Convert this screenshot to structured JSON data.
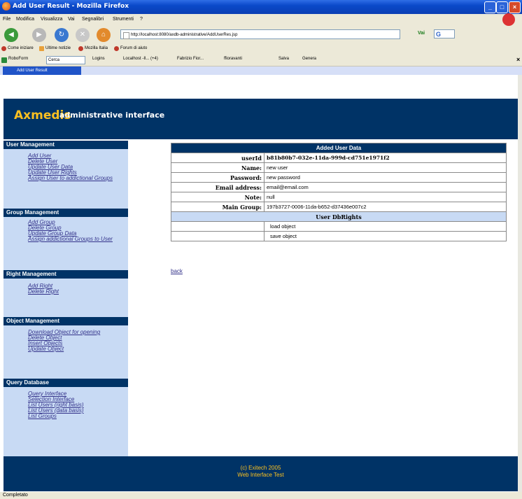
{
  "window": {
    "title": "Add User Result - Mozilla Firefox"
  },
  "menu": [
    "File",
    "Modifica",
    "Visualizza",
    "Vai",
    "Segnalibri",
    "Strumenti",
    "?"
  ],
  "address": {
    "url": "http://localhost:8080/axdb-administrative/AddUserRes.jsp",
    "go_label": "Vai"
  },
  "bookmarks": [
    "Come iniziare",
    "Ultime notizie",
    "Mozilla Italia",
    "Forum di aiuto"
  ],
  "toolbar2": {
    "roboform": "RoboForm",
    "search": "Cerca",
    "logins": "Logins",
    "localhost": "Localhost -Il... (+4)",
    "fabrizio": "Fabrizio Fior...",
    "fioravanti": "ffioravanti",
    "salva": "Salva",
    "genera": "Genera"
  },
  "tab": {
    "label": "Add User Result"
  },
  "header": {
    "brand": "Axmedis",
    "subtitle": "administrative interface"
  },
  "sidebar": [
    {
      "title": "User Management",
      "links": [
        "Add User",
        "Delete User",
        "Update User Data",
        "Update User Rights",
        "Assign User to addictional Groups"
      ]
    },
    {
      "title": "Group Management",
      "links": [
        "Add Group",
        "Delete Group",
        "Update Group Data",
        "Assign addictional Groups to User"
      ]
    },
    {
      "title": "Right Management",
      "links": [
        "Add Right",
        "Delete Right"
      ]
    },
    {
      "title": "Object Management",
      "links": [
        "Download Object for opening",
        "Delete Object",
        "Insert Objects",
        "Update Object"
      ]
    },
    {
      "title": "Query Database",
      "links": [
        "Query Interface",
        "Selection Interface",
        "List Users (right basis)",
        "List Users (data basis)",
        "List Groups"
      ]
    }
  ],
  "table": {
    "title": "Added User Data",
    "rows": [
      {
        "label": "userId",
        "value": "b81b80b7-032e-11da-999d-cd751e1971f2"
      },
      {
        "label": "Name:",
        "value": "new user"
      },
      {
        "label": "Password:",
        "value": "new password"
      },
      {
        "label": "Email address:",
        "value": "email@email.com"
      },
      {
        "label": "Note:",
        "value": "null"
      },
      {
        "label": "Main Group:",
        "value": "197b3727-0006-11da-b652-d37436e007c2"
      }
    ],
    "rights_title": "User DbRights",
    "rights": [
      "load object",
      "save object"
    ]
  },
  "back_label": "back",
  "footer": {
    "line1": "(c) Exitech 2005",
    "line2": "Web Interface Test"
  },
  "status": "Completato"
}
